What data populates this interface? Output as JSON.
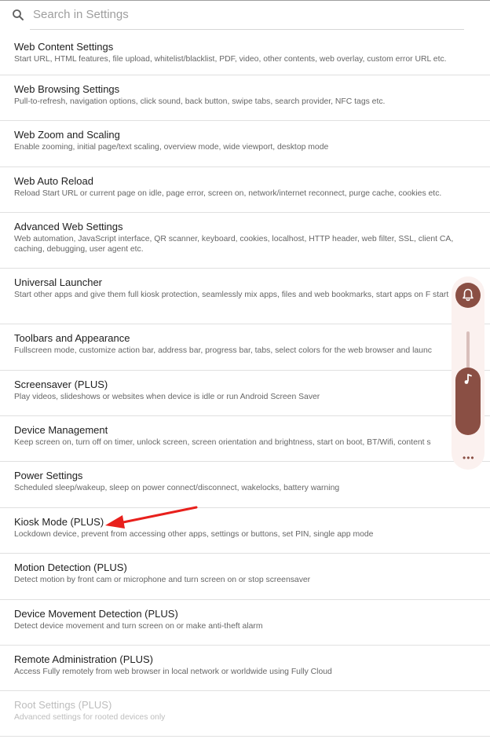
{
  "search": {
    "placeholder": "Search in Settings"
  },
  "items": [
    {
      "title": "Web Content Settings",
      "subtitle": "Start URL, HTML features, file upload, whitelist/blacklist, PDF, video, other contents, web overlay, custom error URL etc."
    },
    {
      "title": "Web Browsing Settings",
      "subtitle": "Pull-to-refresh, navigation options, click sound, back button, swipe tabs, search provider, NFC tags etc."
    },
    {
      "title": "Web Zoom and Scaling",
      "subtitle": "Enable zooming, initial page/text scaling, overview mode, wide viewport, desktop mode"
    },
    {
      "title": "Web Auto Reload",
      "subtitle": "Reload Start URL or current page on idle, page error, screen on, network/internet reconnect, purge cache, cookies etc."
    },
    {
      "title": "Advanced Web Settings",
      "subtitle": "Web automation, JavaScript interface, QR scanner, keyboard, cookies, localhost, HTTP header, web filter, SSL, client CA, caching, debugging, user agent etc."
    },
    {
      "title": "Universal Launcher",
      "subtitle": "Start other apps and give them full kiosk protection, seamlessly mix apps, files and web bookmarks, start apps on F start"
    },
    {
      "title": "Toolbars and Appearance",
      "subtitle": "Fullscreen mode, customize action bar, address bar, progress bar, tabs, select colors for the web browser and launc"
    },
    {
      "title": "Screensaver (PLUS)",
      "subtitle": "Play videos, slideshows or websites when device is idle or run Android Screen Saver"
    },
    {
      "title": "Device Management",
      "subtitle": "Keep screen on, turn off on timer, unlock screen, screen orientation and brightness, start on boot, BT/Wifi, content s"
    },
    {
      "title": "Power Settings",
      "subtitle": "Scheduled sleep/wakeup, sleep on power connect/disconnect, wakelocks, battery warning"
    },
    {
      "title": "Kiosk Mode (PLUS)",
      "subtitle": "Lockdown device, prevent from accessing other apps, settings or buttons, set PIN, single app mode"
    },
    {
      "title": "Motion Detection (PLUS)",
      "subtitle": "Detect motion by front cam or microphone and turn screen on or stop screensaver"
    },
    {
      "title": "Device Movement Detection (PLUS)",
      "subtitle": "Detect device movement and turn screen on or make anti-theft alarm"
    },
    {
      "title": "Remote Administration (PLUS)",
      "subtitle": "Access Fully remotely from web browser in local network or worldwide using Fully Cloud"
    },
    {
      "title": "Root Settings (PLUS)",
      "subtitle": "Advanced settings for rooted devices only",
      "disabled": true
    }
  ],
  "volume_panel": {
    "more_label": "•••",
    "accent": "#8a4f44"
  },
  "annotation": {
    "color": "#e8201c"
  }
}
